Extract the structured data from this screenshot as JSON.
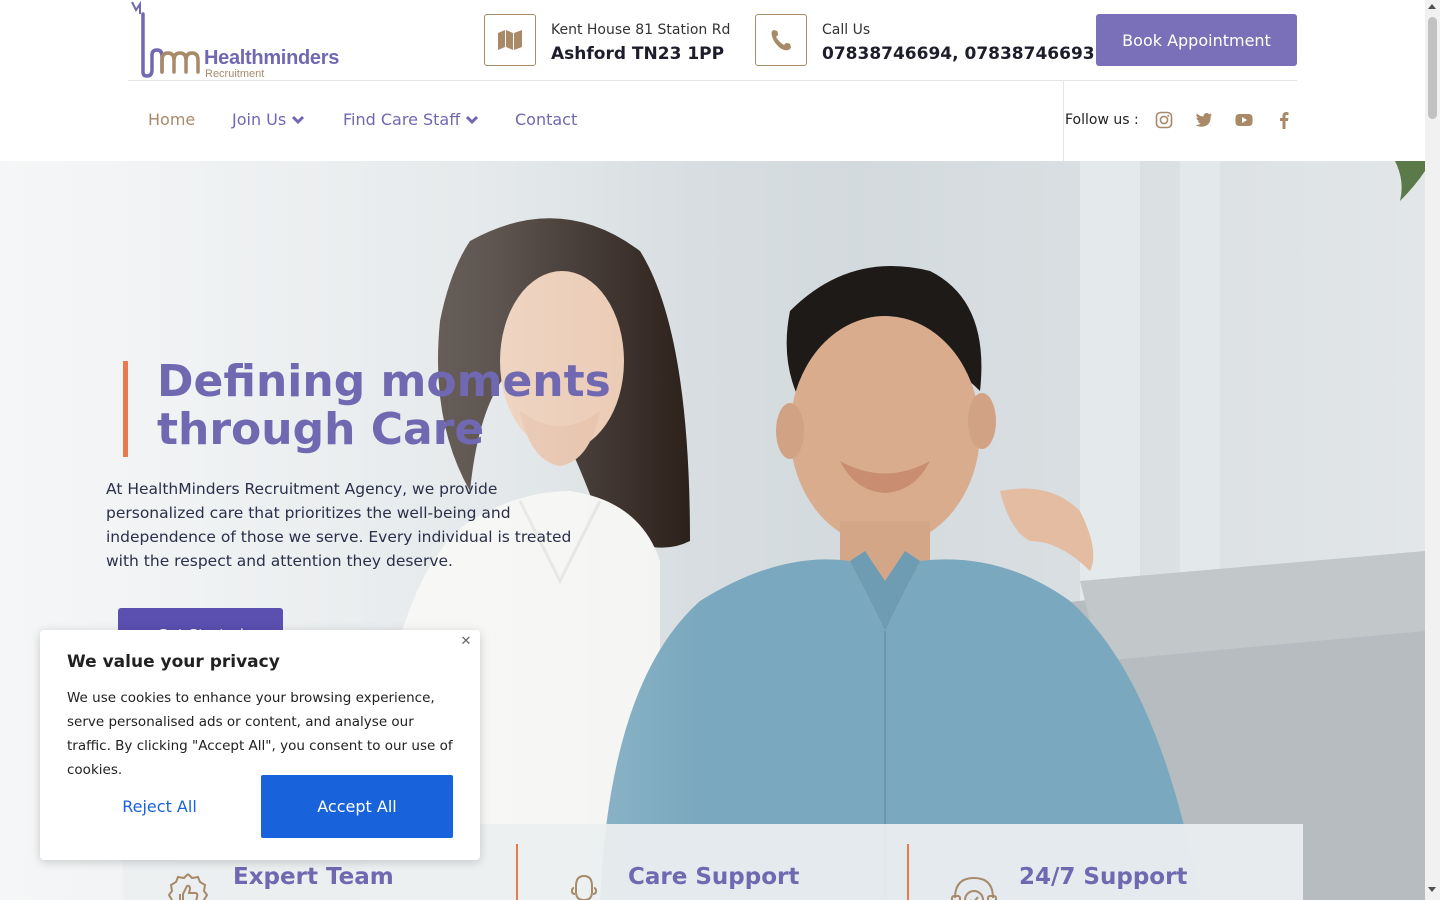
{
  "brand": {
    "name": "Healthminders",
    "tagline": "Recruitment",
    "primary_color": "#7a70b9",
    "accent_color": "#a88a69",
    "highlight_color": "#e87a50"
  },
  "header": {
    "address": {
      "icon": "map-icon",
      "label": "Kent House 81 Station Rd",
      "value": "Ashford TN23 1PP"
    },
    "phone": {
      "icon": "phone-icon",
      "label": "Call Us",
      "value": "07838746694, 07838746693"
    },
    "book_button": "Book Appointment"
  },
  "nav": {
    "items": [
      {
        "label": "Home",
        "active": true,
        "dropdown": false
      },
      {
        "label": "Join Us",
        "active": false,
        "dropdown": true
      },
      {
        "label": "Find Care Staff",
        "active": false,
        "dropdown": true
      },
      {
        "label": "Contact",
        "active": false,
        "dropdown": false
      }
    ],
    "follow_label": "Follow us :",
    "social": [
      "instagram-icon",
      "twitter-icon",
      "youtube-icon",
      "facebook-icon"
    ]
  },
  "hero": {
    "title": "Defining moments through Care",
    "text": "At HealthMinders Recruitment Agency, we provide personalized care that prioritizes the well-being and independence of those we serve. Every individual is treated with the respect and attention they deserve.",
    "cta": "Get Started"
  },
  "features": [
    {
      "title": "Expert Team",
      "icon": "thumbs-up-badge-icon"
    },
    {
      "title": "Care Support",
      "icon": "person-icon"
    },
    {
      "title": "24/7 Support",
      "icon": "headset-icon"
    }
  ],
  "cookie": {
    "title": "We value your privacy",
    "text": "We use cookies to enhance your browsing experience, serve personalised ads or content, and analyse our traffic. By clicking \"Accept All\", you consent to our use of cookies.",
    "reject": "Reject All",
    "accept": "Accept All",
    "close": "✕"
  }
}
